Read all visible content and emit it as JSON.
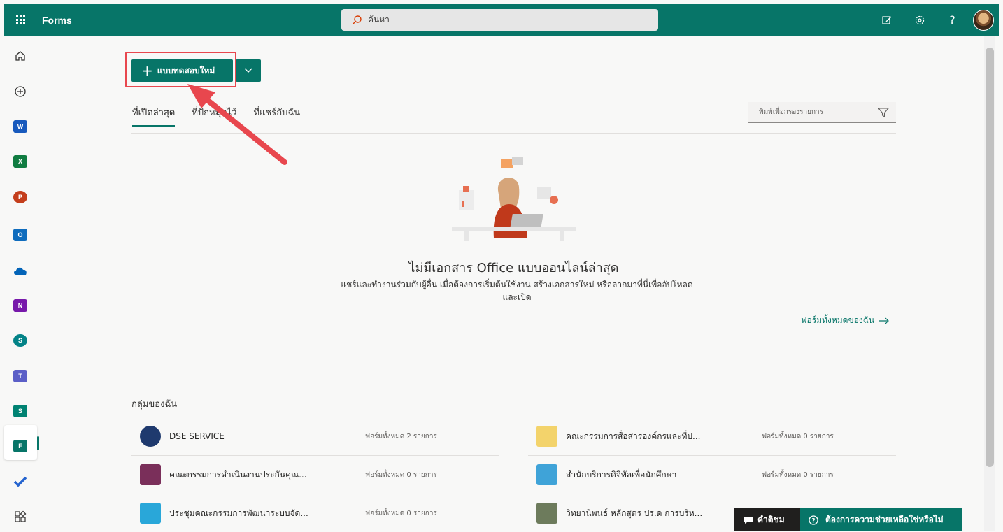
{
  "app": {
    "name": "Forms"
  },
  "search": {
    "placeholder": "ค้นหา"
  },
  "new_button": {
    "label": "แบบทดสอบใหม่"
  },
  "tabs": [
    {
      "label": "ที่เปิดล่าสุด"
    },
    {
      "label": "ที่ปักหมุดไว้"
    },
    {
      "label": "ที่แชร์กับฉัน"
    }
  ],
  "filter": {
    "placeholder": "พิมพ์เพื่อกรองรายการ"
  },
  "empty_state": {
    "title": "ไม่มีเอกสาร Office แบบออนไลน์ล่าสุด",
    "description_line1": "แชร์และทำงานร่วมกับผู้อื่น เมื่อต้องการเริ่มต้นใช้งาน สร้างเอกสารใหม่ หรือลากมาที่นี่เพื่ออัปโหลด",
    "description_line2": "และเปิด"
  },
  "all_forms_link": "ฟอร์มทั้งหมดของฉัน",
  "groups": {
    "title": "กลุ่มของฉัน",
    "items": [
      {
        "name": "DSE SERVICE",
        "count": "ฟอร์มทั้งหมด 2 รายการ",
        "thumb": "#1f3a6e"
      },
      {
        "name": "คณะกรรมการสื่อสารองค์กรและที่ป...",
        "count": "ฟอร์มทั้งหมด 0 รายการ",
        "thumb": "#f3d36b"
      },
      {
        "name": "คณะกรรมการดำเนินงานประกันคุณ...",
        "count": "ฟอร์มทั้งหมด 0 รายการ",
        "thumb": "#7a2f5a"
      },
      {
        "name": "สำนักบริการดิจิทัลเพื่อนักศึกษา",
        "count": "ฟอร์มทั้งหมด 0 รายการ",
        "thumb": "#3fa3d8"
      },
      {
        "name": "ประชุมคณะกรรมการพัฒนาระบบจัด...",
        "count": "ฟอร์มทั้งหมด 0 รายการ",
        "thumb": "#29a7d9"
      },
      {
        "name": "วิทยานิพนธ์ หลักสูตร ปร.ด การบริห...",
        "count": "",
        "thumb": "#6d7b5c"
      }
    ]
  },
  "feedback": {
    "label": "คำติชม"
  },
  "help": {
    "label": "ต้องการความช่วยเหลือใช่หรือไม่"
  },
  "colors": {
    "brand": "#077568",
    "arrow": "#e8474e"
  }
}
